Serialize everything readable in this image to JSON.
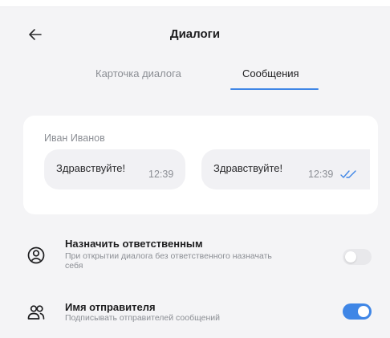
{
  "header": {
    "title": "Диалоги",
    "back_icon": "arrow-left-icon"
  },
  "tabs": [
    {
      "label": "Карточка диалога",
      "active": false
    },
    {
      "label": "Сообщения",
      "active": true
    }
  ],
  "preview": {
    "sender": "Иван Иванов",
    "messages": [
      {
        "text": "Здравствуйте!",
        "time": "12:39",
        "read_icon": ""
      },
      {
        "text": "Здравствуйте!",
        "time": "12:39",
        "read_icon": "double-check-icon"
      }
    ]
  },
  "settings": [
    {
      "icon": "user-circle-icon",
      "title": "Назначить ответственным",
      "description": "При открытии диалога без ответственного назначать себя",
      "enabled": false
    },
    {
      "icon": "users-icon",
      "title": "Имя отправителя",
      "description": "Подписывать отправителей сообщений",
      "enabled": true
    }
  ],
  "colors": {
    "accent": "#3f86e6",
    "background": "#f4f4f6",
    "card": "#ffffff",
    "bubble": "#f1f1f4",
    "muted_text": "#8b8e94"
  }
}
